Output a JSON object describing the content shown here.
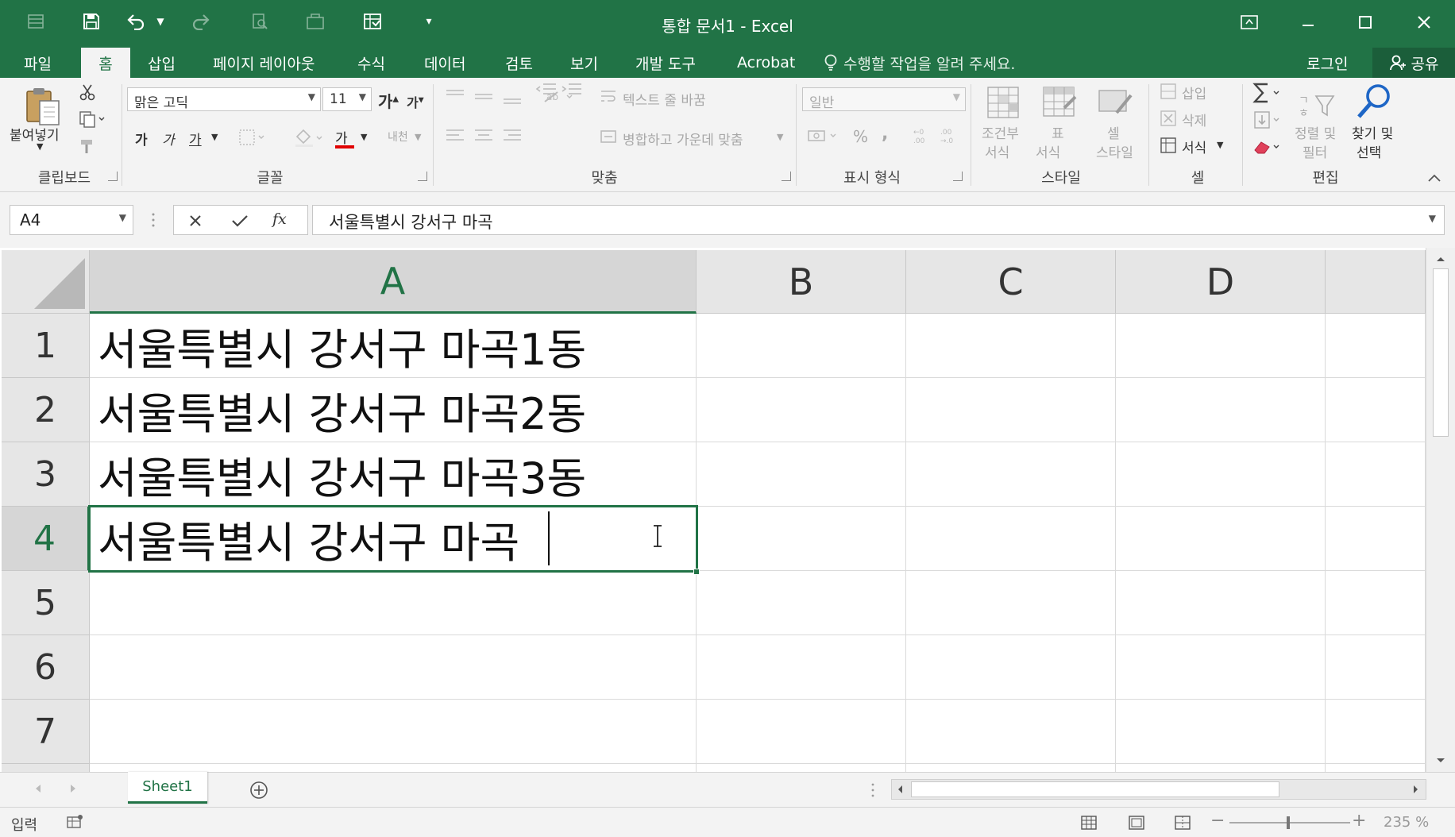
{
  "window": {
    "title": "통합 문서1 - Excel",
    "accent_color": "#217346"
  },
  "quick_access": {
    "icons": [
      "save-icon",
      "undo-icon",
      "redo-icon",
      "print-preview-icon",
      "customize-icon"
    ]
  },
  "tabs": [
    "파일",
    "홈",
    "삽입",
    "페이지 레이아웃",
    "수식",
    "데이터",
    "검토",
    "보기",
    "개발 도구",
    "Acrobat"
  ],
  "active_tab": "홈",
  "tell_me": "수행할 작업을 알려 주세요.",
  "login": "로그인",
  "share": "공유",
  "ribbon": {
    "clipboard": {
      "paste": "붙여넣기",
      "label": "클립보드"
    },
    "font": {
      "name": "맑은 고딕",
      "size": "11",
      "grow": "가",
      "shrink": "가",
      "bold": "가",
      "italic": "가",
      "underline": "가",
      "font_color_glyph": "가",
      "phonetic": "내천",
      "label": "글꼴"
    },
    "alignment": {
      "wrap_text": "텍스트 줄 바꿈",
      "merge_center": "병합하고 가운데 맞춤",
      "label": "맞춤"
    },
    "number": {
      "format": "일반",
      "percent": "%",
      "comma": ",",
      "label": "표시 형식"
    },
    "styles": {
      "conditional_1": "조건부",
      "conditional_2": "서식",
      "table_1": "표",
      "table_2": "서식",
      "cell_1": "셀",
      "cell_2": "스타일",
      "label": "스타일"
    },
    "cells": {
      "insert": "삽입",
      "delete": "삭제",
      "format": "서식",
      "label": "셀"
    },
    "editing": {
      "sort_1": "정렬 및",
      "sort_2": "필터",
      "find_1": "찾기 및",
      "find_2": "선택",
      "label": "편집"
    }
  },
  "formula_bar": {
    "name_box": "A4",
    "fx": "fx",
    "content": "서울특별시 강서구 마곡"
  },
  "columns": [
    "A",
    "B",
    "C",
    "D"
  ],
  "rows": [
    "1",
    "2",
    "3",
    "4",
    "5",
    "6",
    "7"
  ],
  "cells": {
    "A1": "서울특별시 강서구 마곡1동",
    "A2": "서울특별시 강서구 마곡2동",
    "A3": "서울특별시 강서구 마곡3동",
    "A4": "서울특별시 강서구 마곡"
  },
  "selected_cell": "A4",
  "sheet_tabs": [
    "Sheet1"
  ],
  "status": {
    "mode": "입력",
    "zoom": "235 %"
  }
}
